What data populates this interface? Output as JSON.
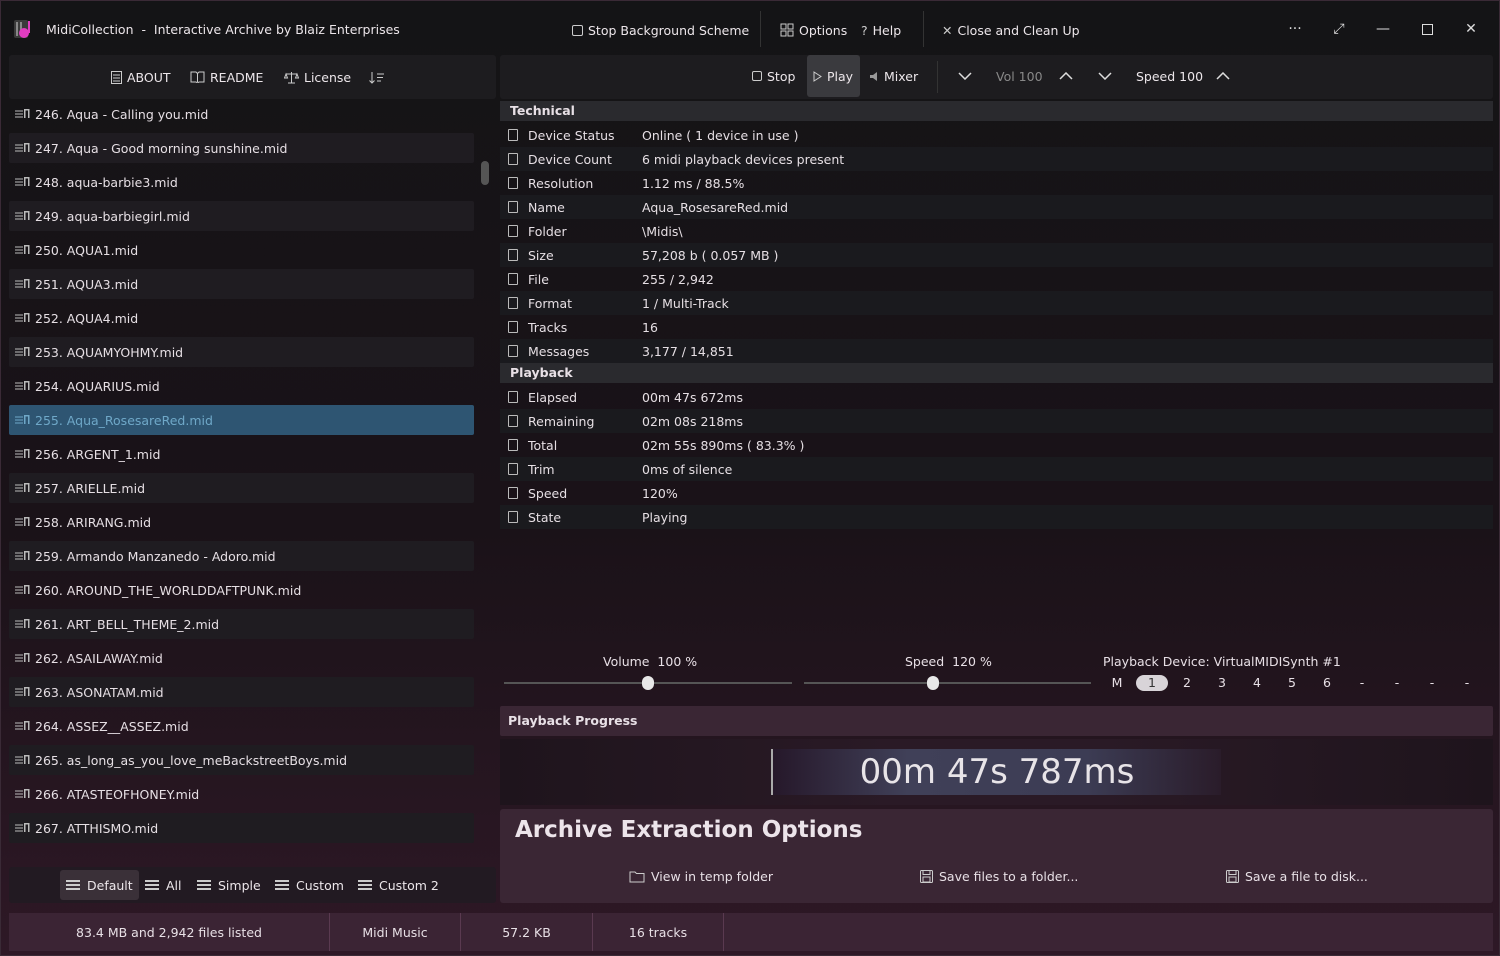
{
  "app": {
    "title": "MidiCollection  -  Interactive Archive by Blaiz Enterprises",
    "titlebar": {
      "stop_bg_scheme": "Stop Background Scheme",
      "options": "Options",
      "help": "Help",
      "close_clean": "Close and Clean Up"
    }
  },
  "left_toolbar": {
    "about": "ABOUT",
    "readme": "README",
    "license": "License"
  },
  "files": [
    {
      "label": "246. Aqua - Calling you.mid"
    },
    {
      "label": "247. Aqua - Good morning sunshine.mid"
    },
    {
      "label": "248. aqua-barbie3.mid"
    },
    {
      "label": "249. aqua-barbiegirl.mid"
    },
    {
      "label": "250. AQUA1.mid"
    },
    {
      "label": "251. AQUA3.mid"
    },
    {
      "label": "252. AQUA4.mid"
    },
    {
      "label": "253. AQUAMYOHMY.mid"
    },
    {
      "label": "254. AQUARIUS.mid"
    },
    {
      "label": "255. Aqua_RosesareRed.mid",
      "selected": true
    },
    {
      "label": "256. ARGENT_1.mid"
    },
    {
      "label": "257. ARIELLE.mid"
    },
    {
      "label": "258. ARIRANG.mid"
    },
    {
      "label": "259. Armando Manzanedo - Adoro.mid"
    },
    {
      "label": "260. AROUND_THE_WORLDDAFTPUNK.mid"
    },
    {
      "label": "261. ART_BELL_THEME_2.mid"
    },
    {
      "label": "262. ASAILAWAY.mid"
    },
    {
      "label": "263. ASONATAM.mid"
    },
    {
      "label": "264. ASSEZ__ASSEZ.mid"
    },
    {
      "label": "265. as_long_as_you_love_meBackstreetBoys.mid"
    },
    {
      "label": "266. ATASTEOFHONEY.mid"
    },
    {
      "label": "267. ATTHISMO.mid"
    }
  ],
  "left_bottom": {
    "default": "Default",
    "all": "All",
    "simple": "Simple",
    "custom": "Custom",
    "custom2": "Custom 2"
  },
  "right_toolbar": {
    "stop": "Stop",
    "play": "Play",
    "mixer": "Mixer",
    "vol": "Vol 100",
    "speed": "Speed 100"
  },
  "technical": {
    "heading": "Technical",
    "rows": [
      {
        "label": "Device Status",
        "value": "Online  ( 1 device in use )"
      },
      {
        "label": "Device Count",
        "value": "6 midi playback devices present"
      },
      {
        "label": "Resolution",
        "value": "1.12 ms / 88.5%"
      },
      {
        "label": "Name",
        "value": "Aqua_RosesareRed.mid"
      },
      {
        "label": "Folder",
        "value": "\\Midis\\"
      },
      {
        "label": "Size",
        "value": "57,208 b  ( 0.057 MB )"
      },
      {
        "label": "File",
        "value": "255 / 2,942"
      },
      {
        "label": "Format",
        "value": "1 / Multi-Track"
      },
      {
        "label": "Tracks",
        "value": "16"
      },
      {
        "label": "Messages",
        "value": "3,177 / 14,851"
      }
    ]
  },
  "playback": {
    "heading": "Playback",
    "rows": [
      {
        "label": "Elapsed",
        "value": "00m 47s 672ms"
      },
      {
        "label": "Remaining",
        "value": "02m 08s 218ms"
      },
      {
        "label": "Total",
        "value": "02m 55s 890ms ( 83.3% )"
      },
      {
        "label": "Trim",
        "value": "0ms of silence"
      },
      {
        "label": "Speed",
        "value": "120%"
      },
      {
        "label": "State",
        "value": "Playing"
      }
    ]
  },
  "controls": {
    "volume_label": "Volume  100 %",
    "volume_level": 0.5,
    "speed_label": "Speed  120 %",
    "speed_level": 0.45,
    "device_label": "Playback Device: VirtualMIDISynth #1",
    "channels": [
      "M",
      "1",
      "2",
      "3",
      "4",
      "5",
      "6",
      "-",
      "-",
      "-",
      "-"
    ],
    "active_channel": 1
  },
  "progress": {
    "heading": "Playback Progress",
    "time": "00m 47s 787ms"
  },
  "archive": {
    "title": "Archive Extraction Options",
    "view_temp": "View in temp folder",
    "save_folder": "Save files to a folder...",
    "save_file": "Save a file to disk..."
  },
  "status": {
    "summary": "83.4 MB and 2,942 files listed",
    "type": "Midi Music",
    "size": "57.2 KB",
    "tracks": "16 tracks"
  }
}
